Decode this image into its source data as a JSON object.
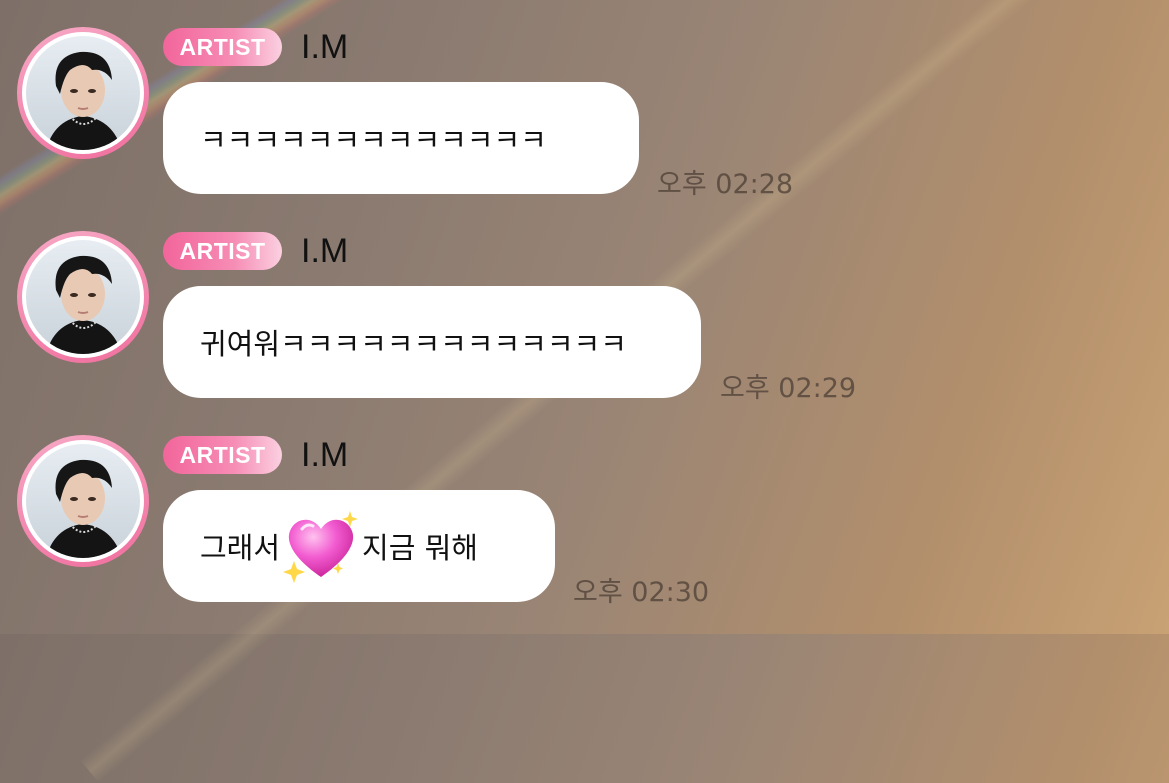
{
  "messages": [
    {
      "badge": "ARTIST",
      "sender": "I.M",
      "text": "ㅋㅋㅋㅋㅋㅋㅋㅋㅋㅋㅋㅋㅋ",
      "time": "오후 02:28"
    },
    {
      "badge": "ARTIST",
      "sender": "I.M",
      "text": "귀여워ㅋㅋㅋㅋㅋㅋㅋㅋㅋㅋㅋㅋㅋ",
      "time": "오후 02:29"
    },
    {
      "badge": "ARTIST",
      "sender": "I.M",
      "text_before": "그래서",
      "emoji": "sparkling-heart",
      "text_after": "지금 뭐해",
      "time": "오후 02:30"
    }
  ],
  "colors": {
    "badge_pink": "#f2659b",
    "avatar_ring": "#f06e9d",
    "bubble": "#ffffff"
  }
}
